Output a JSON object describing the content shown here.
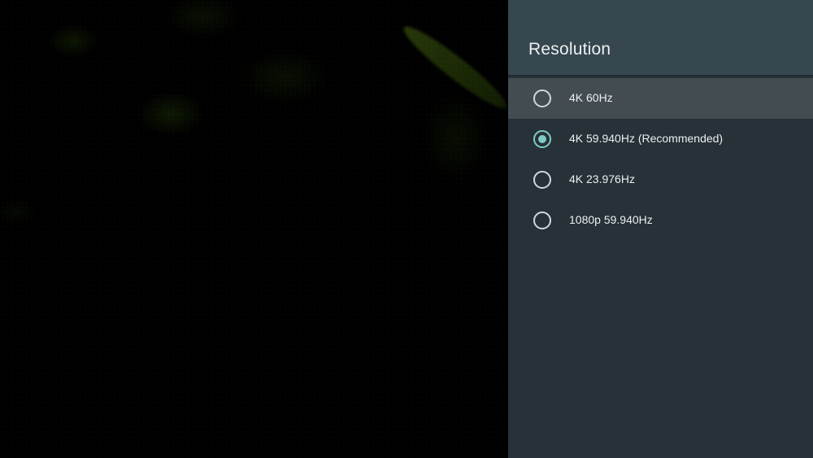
{
  "panel": {
    "title": "Resolution",
    "options": [
      {
        "label": "4K 60Hz",
        "selected": false,
        "focused": true
      },
      {
        "label": "4K 59.940Hz (Recommended)",
        "selected": true,
        "focused": false
      },
      {
        "label": "4K 23.976Hz",
        "selected": false,
        "focused": false
      },
      {
        "label": "1080p 59.940Hz",
        "selected": false,
        "focused": false
      }
    ]
  },
  "colors": {
    "panel_background": "#263238",
    "header_background": "#37474f",
    "focused_row": "#424c51",
    "accent": "#80cbc4",
    "text": "#eceff1"
  },
  "icons": {
    "radio_unchecked": "radio-unchecked-icon",
    "radio_checked": "radio-checked-icon"
  }
}
